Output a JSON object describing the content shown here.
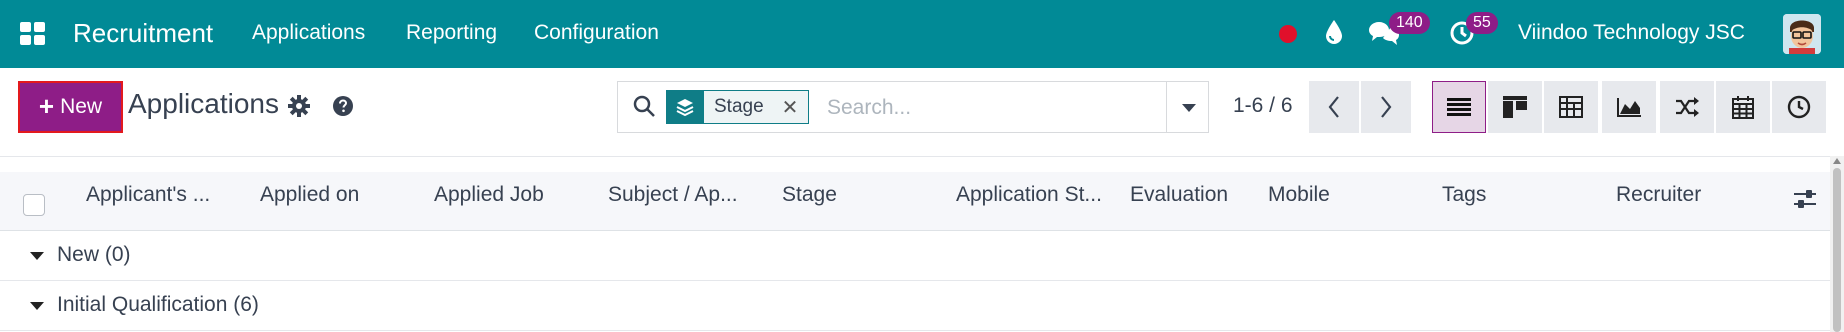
{
  "navbar": {
    "app_name": "Recruitment",
    "menu": [
      "Applications",
      "Reporting",
      "Configuration"
    ],
    "messages_count": "140",
    "activities_count": "55",
    "company": "Viindoo Technology JSC",
    "colors": {
      "bar": "#018a96",
      "badge": "#8e1d87",
      "recording": "#e0102b"
    }
  },
  "control_panel": {
    "new_label": "New",
    "title": "Applications",
    "search": {
      "facet_value": "Stage",
      "placeholder": "Search..."
    },
    "pager": "1-6 / 6",
    "views": [
      "list-icon",
      "kanban-icon",
      "pivot-icon",
      "graph-icon",
      "cohort-icon",
      "calendar-icon",
      "activity-icon"
    ]
  },
  "table": {
    "columns": [
      "Applicant's ...",
      "Applied on",
      "Applied Job",
      "Subject / Ap...",
      "Stage",
      "Application St...",
      "Evaluation",
      "Mobile",
      "Tags",
      "Recruiter"
    ],
    "groups": [
      {
        "label": "New (0)"
      },
      {
        "label": "Initial Qualification (6)"
      }
    ]
  }
}
